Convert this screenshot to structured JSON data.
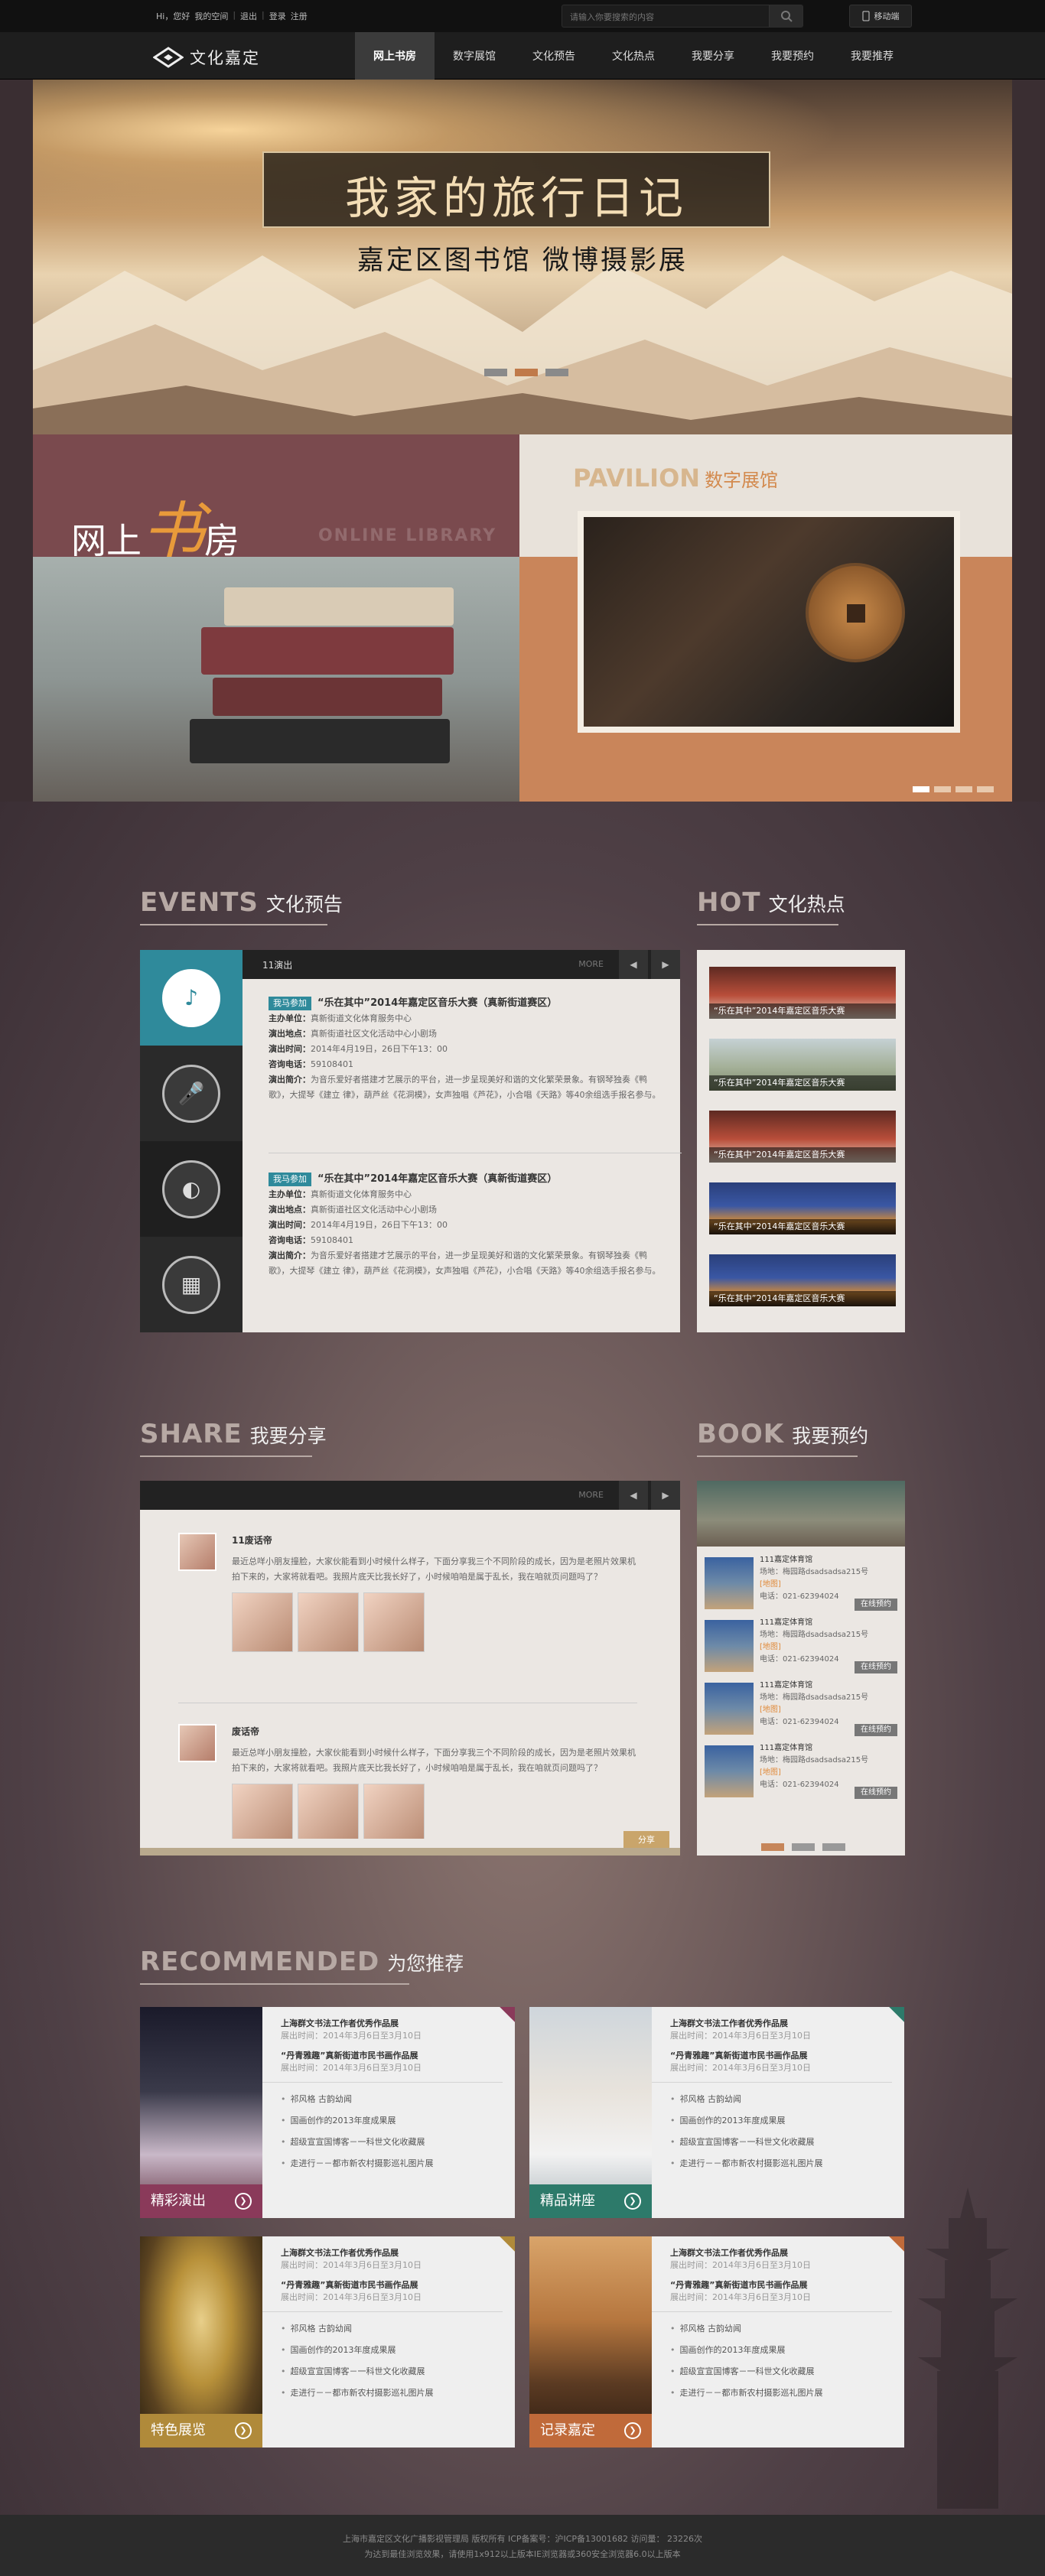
{
  "top": {
    "links": [
      "Hi，您好",
      "我的空间",
      "退出",
      "登录",
      "注册"
    ],
    "search_placeholder": "请输入你要搜索的内容",
    "mobile_label": "移动端"
  },
  "nav": {
    "logo_text": "文化嘉定",
    "items": [
      "网上书房",
      "数字展馆",
      "文化预告",
      "文化热点",
      "我要分享",
      "我要预约",
      "我要推荐"
    ]
  },
  "hero": {
    "title": "我家的旅行日记",
    "subtitle": "嘉定区图书馆 微博摄影展"
  },
  "promo": {
    "library_label_1": "网上",
    "library_label_big": "书",
    "library_label_2": "房",
    "library_sub": "ONLINE LIBRARY",
    "pavilion_en": "PAVILION",
    "pavilion_cn": "数字展馆"
  },
  "events": {
    "title_en": "EVENTS",
    "title_cn": "文化预告",
    "panel_title": "11演出",
    "more": "MORE",
    "entries": [
      {
        "tag": "我马参加",
        "title": "“乐在其中”2014年嘉定区音乐大赛（真新街道赛区）",
        "organizer_label": "主办单位：",
        "organizer": "真新街道文化体育服务中心",
        "venue_label": "演出地点：",
        "venue": "真新街道社区文化活动中心小剧场",
        "time_label": "演出时间：",
        "time": "2014年4月19日，26日下午13：00",
        "phone_label": "咨询电话：",
        "phone": "59108401",
        "intro_label": "演出简介：",
        "intro": "为音乐爱好者搭建才艺展示的平台，进一步呈现美好和谐的文化繁荣景象。有钢琴独奏《鸭歌》，大提琴《建立 律》，葫芦丝《花洞模》，女声独唱《芦花》，小合唱《天路》等40余组选手报名参与。"
      },
      {
        "tag": "我马参加",
        "title": "“乐在其中”2014年嘉定区音乐大赛（真新街道赛区）",
        "organizer_label": "主办单位：",
        "organizer": "真新街道文化体育服务中心",
        "venue_label": "演出地点：",
        "venue": "真新街道社区文化活动中心小剧场",
        "time_label": "演出时间：",
        "time": "2014年4月19日，26日下午13：00",
        "phone_label": "咨询电话：",
        "phone": "59108401",
        "intro_label": "演出简介：",
        "intro": "为音乐爱好者搭建才艺展示的平台，进一步呈现美好和谐的文化繁荣景象。有钢琴独奏《鸭歌》，大提琴《建立 律》，葫芦丝《花洞模》，女声独唱《芦花》，小合唱《天路》等40余组选手报名参与。"
      }
    ]
  },
  "hot": {
    "title_en": "HOT",
    "title_cn": "文化热点",
    "items": [
      "“乐在其中”2014年嘉定区音乐大赛",
      "“乐在其中”2014年嘉定区音乐大赛",
      "“乐在其中”2014年嘉定区音乐大赛",
      "“乐在其中”2014年嘉定区音乐大赛",
      "“乐在其中”2014年嘉定区音乐大赛"
    ]
  },
  "share": {
    "title_en": "SHARE",
    "title_cn": "我要分享",
    "more": "MORE",
    "share_button": "分享",
    "entries": [
      {
        "name": "11废话帝",
        "text": "最近总咩小朋友撞脸，大家伙能看到小时候什么样子，下面分享我三个不同阶段的成长，因为是老照片效果机拍下来的，大家将就看吧。我照片底天比我长好了，小时候咱咱是属于乱长，我在咱就页问题吗了？"
      },
      {
        "name": "废话帝",
        "text": "最近总咩小朋友撞脸，大家伙能看到小时候什么样子，下面分享我三个不同阶段的成长，因为是老照片效果机拍下来的，大家将就看吧。我照片底天比我长好了，小时候咱咱是属于乱长，我在咱就页问题吗了？"
      }
    ]
  },
  "book": {
    "title_en": "BOOK",
    "title_cn": "我要预约",
    "items": [
      {
        "name": "111嘉定体育馆",
        "addr": "场地：梅园路dsadsadsa215号",
        "map": "[地图]",
        "tel": "电话：021-62394024",
        "btn": "在线预约"
      },
      {
        "name": "111嘉定体育馆",
        "addr": "场地：梅园路dsadsadsa215号",
        "map": "[地图]",
        "tel": "电话：021-62394024",
        "btn": "在线预约"
      },
      {
        "name": "111嘉定体育馆",
        "addr": "场地：梅园路dsadsadsa215号",
        "map": "[地图]",
        "tel": "电话：021-62394024",
        "btn": "在线预约"
      },
      {
        "name": "111嘉定体育馆",
        "addr": "场地：梅园路dsadsadsa215号",
        "map": "[地图]",
        "tel": "电话：021-62394024",
        "btn": "在线预约"
      }
    ]
  },
  "recommended": {
    "title_en": "RECOMMENDED",
    "title_cn": "为您推荐",
    "cards": [
      {
        "label": "精彩演出",
        "color": "#8a3a5a",
        "t1": "上海群文书法工作者优秀作品展",
        "d1": "展出时间：2014年3月6日至3月10日",
        "t2": "“丹青雅趣”真新街道市民书画作品展",
        "d2": "展出时间：2014年3月6日至3月10日",
        "bullets": [
          "祁风格 古韵幼闻",
          "国画创作的2013年度成果展",
          "超级宣宣国博客－一科世文化收藏展",
          "走进行－－都市新农村摄影巡礼图片展"
        ]
      },
      {
        "label": "精品讲座",
        "color": "#2d7a6a",
        "t1": "上海群文书法工作者优秀作品展",
        "d1": "展出时间：2014年3月6日至3月10日",
        "t2": "“丹青雅趣”真新街道市民书画作品展",
        "d2": "展出时间：2014年3月6日至3月10日",
        "bullets": [
          "祁风格 古韵幼闻",
          "国画创作的2013年度成果展",
          "超级宣宣国博客－一科世文化收藏展",
          "走进行－－都市新农村摄影巡礼图片展"
        ]
      },
      {
        "label": "特色展览",
        "color": "#b08a3a",
        "t1": "上海群文书法工作者优秀作品展",
        "d1": "展出时间：2014年3月6日至3月10日",
        "t2": "“丹青雅趣”真新街道市民书画作品展",
        "d2": "展出时间：2014年3月6日至3月10日",
        "bullets": [
          "祁风格 古韵幼闻",
          "国画创作的2013年度成果展",
          "超级宣宣国博客－一科世文化收藏展",
          "走进行－－都市新农村摄影巡礼图片展"
        ]
      },
      {
        "label": "记录嘉定",
        "color": "#c06a3a",
        "t1": "上海群文书法工作者优秀作品展",
        "d1": "展出时间：2014年3月6日至3月10日",
        "t2": "“丹青雅趣”真新街道市民书画作品展",
        "d2": "展出时间：2014年3月6日至3月10日",
        "bullets": [
          "祁风格 古韵幼闻",
          "国画创作的2013年度成果展",
          "超级宣宣国博客－一科世文化收藏展",
          "走进行－－都市新农村摄影巡礼图片展"
        ]
      }
    ]
  },
  "footer": {
    "line1": "上海市嘉定区文化广播影视管理局 版权所有 ICP备案号：沪ICP备13001682 访问量： 23226次",
    "line2": "为达到最佳浏览效果，请使用1x912以上版本IE浏览器或360安全浏览器6.0以上版本"
  }
}
